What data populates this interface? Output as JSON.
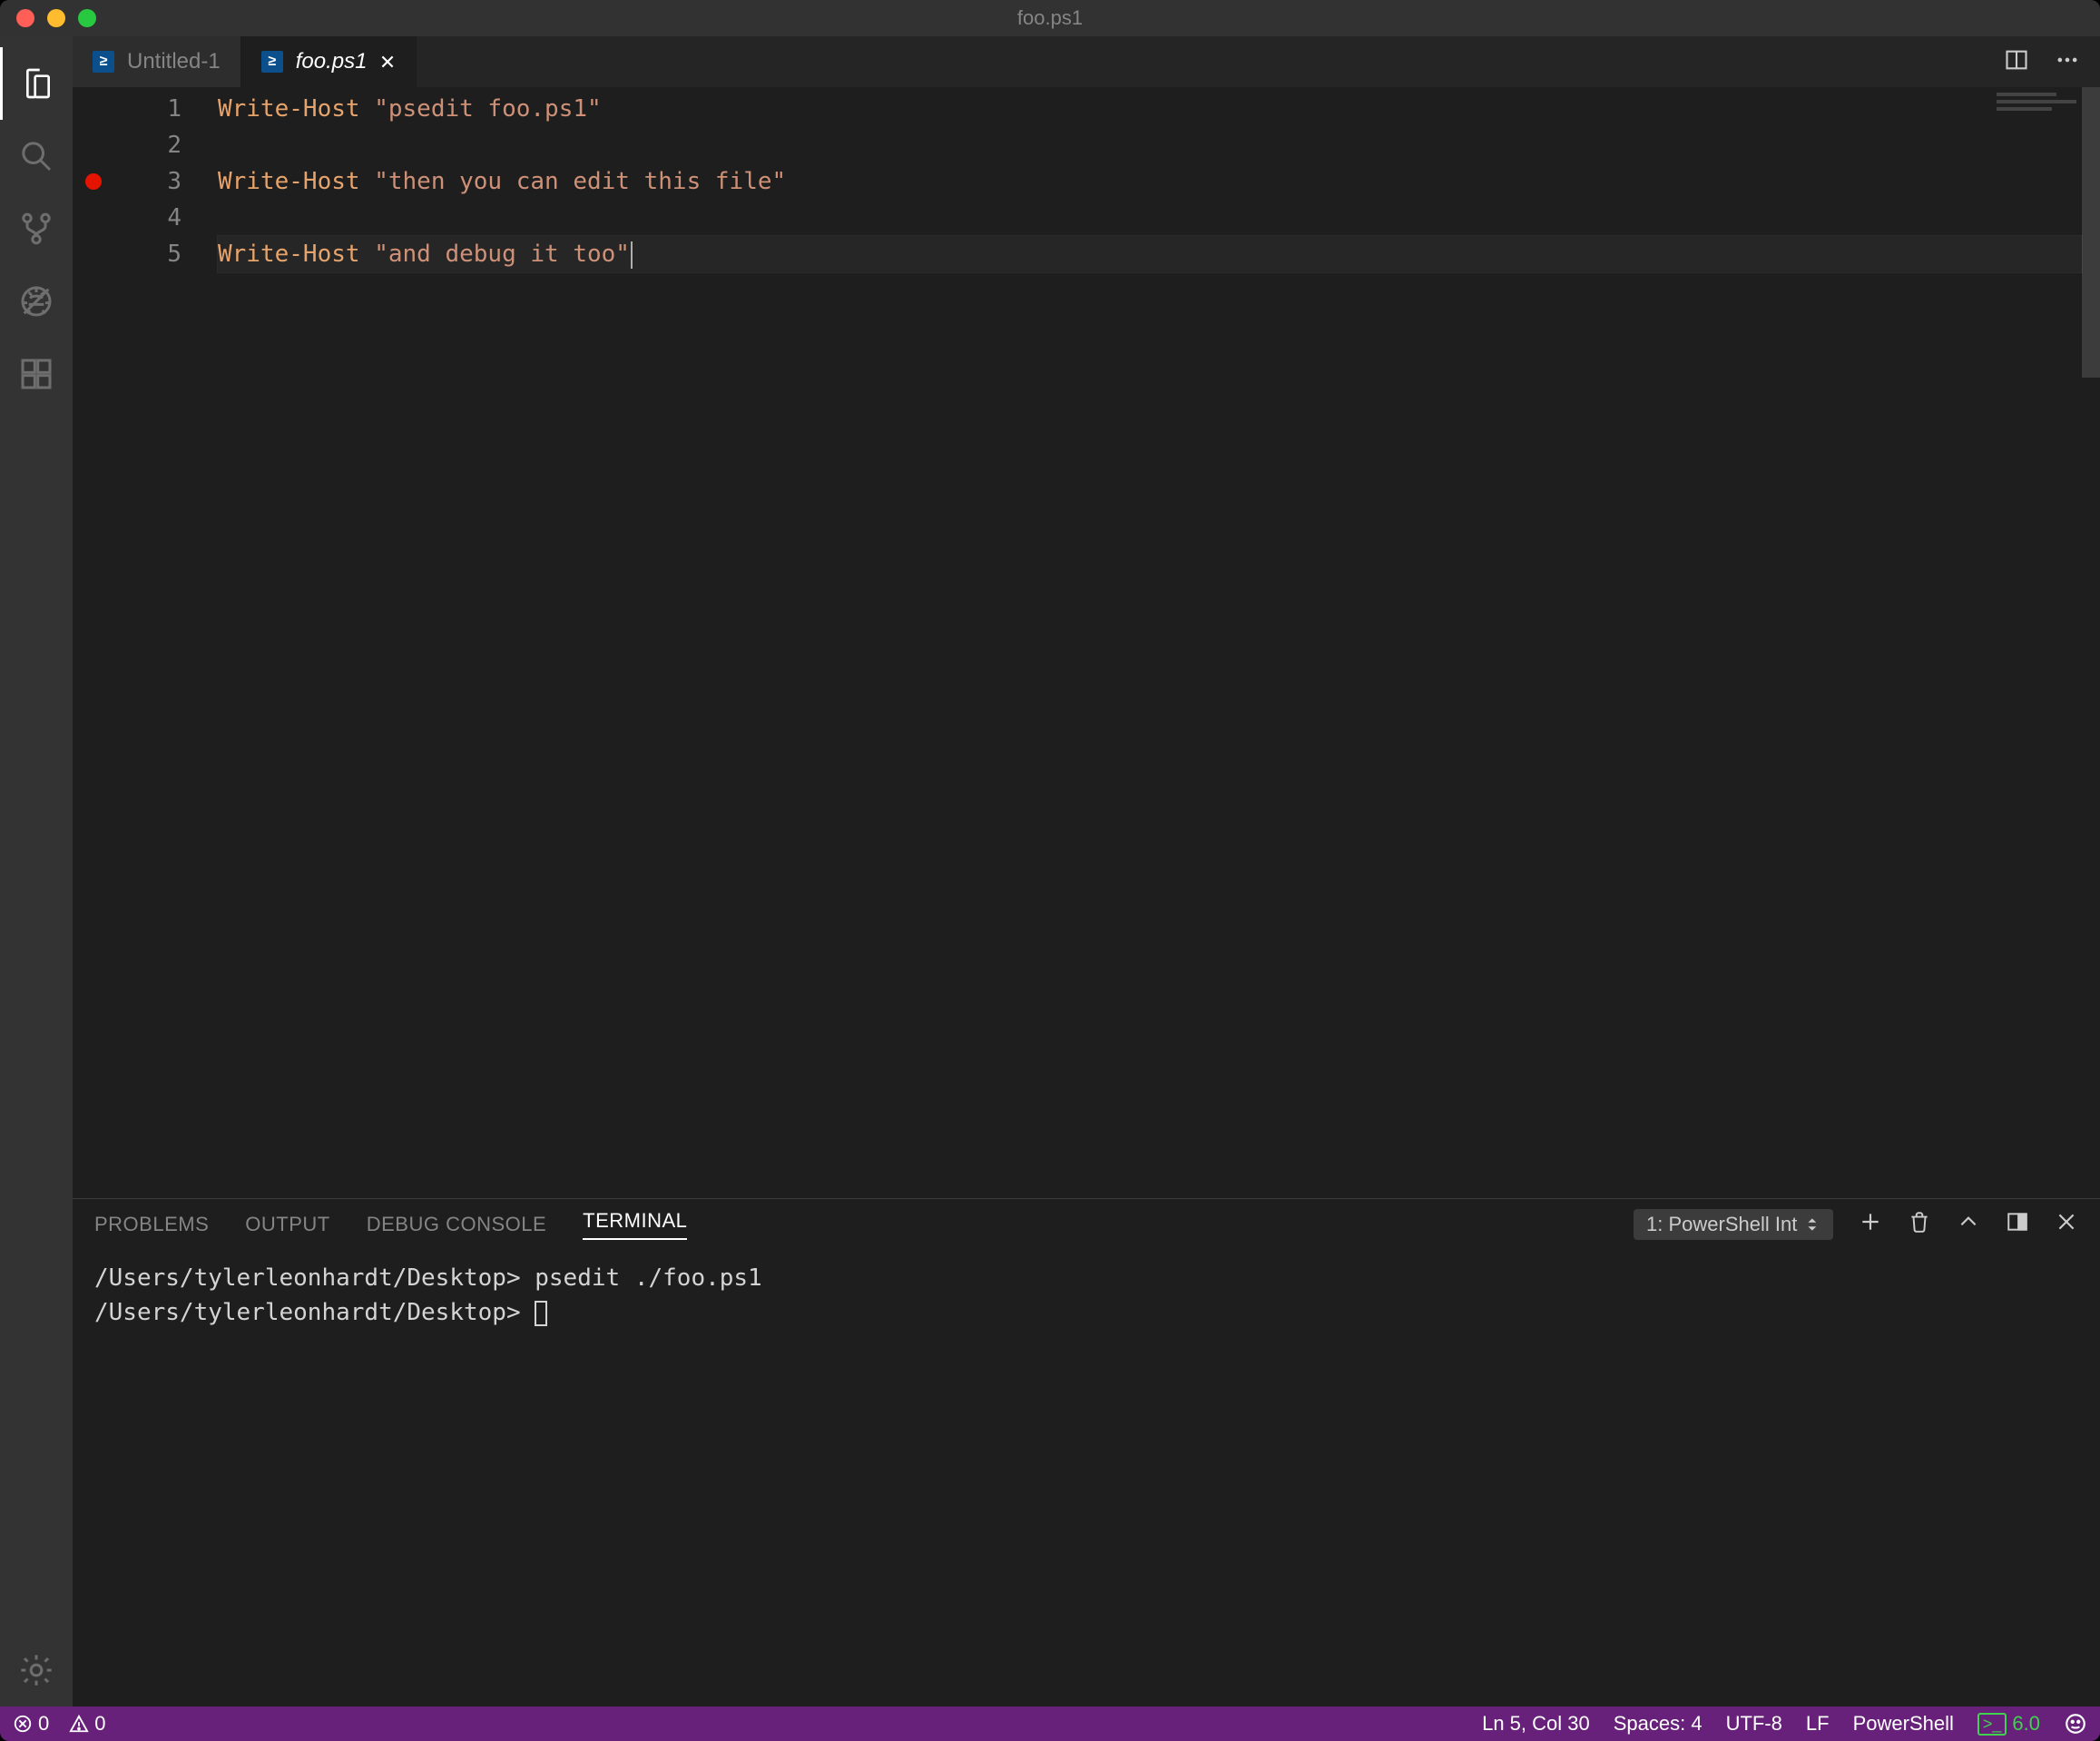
{
  "window": {
    "title": "foo.ps1"
  },
  "tabs": [
    {
      "label": "Untitled-1",
      "active": false
    },
    {
      "label": "foo.ps1",
      "active": true
    }
  ],
  "editor": {
    "lines": [
      {
        "n": 1,
        "cmd": "Write-Host",
        "str": "\"psedit foo.ps1\""
      },
      {
        "n": 2,
        "cmd": "",
        "str": ""
      },
      {
        "n": 3,
        "cmd": "Write-Host",
        "str": "\"then you can edit this file\"",
        "breakpoint": true
      },
      {
        "n": 4,
        "cmd": "",
        "str": ""
      },
      {
        "n": 5,
        "cmd": "Write-Host",
        "str": "\"and debug it too\"",
        "current": true
      }
    ]
  },
  "panel": {
    "tabs": {
      "problems": "PROBLEMS",
      "output": "OUTPUT",
      "debug": "DEBUG CONSOLE",
      "terminal": "TERMINAL"
    },
    "terminal_selector": "1: PowerShell Int",
    "terminal_lines": [
      "/Users/tylerleonhardt/Desktop> psedit ./foo.ps1",
      "/Users/tylerleonhardt/Desktop> "
    ]
  },
  "status": {
    "errors": "0",
    "warnings": "0",
    "cursor": "Ln 5, Col 30",
    "indent": "Spaces: 4",
    "encoding": "UTF-8",
    "eol": "LF",
    "language": "PowerShell",
    "ps_version": "6.0"
  }
}
